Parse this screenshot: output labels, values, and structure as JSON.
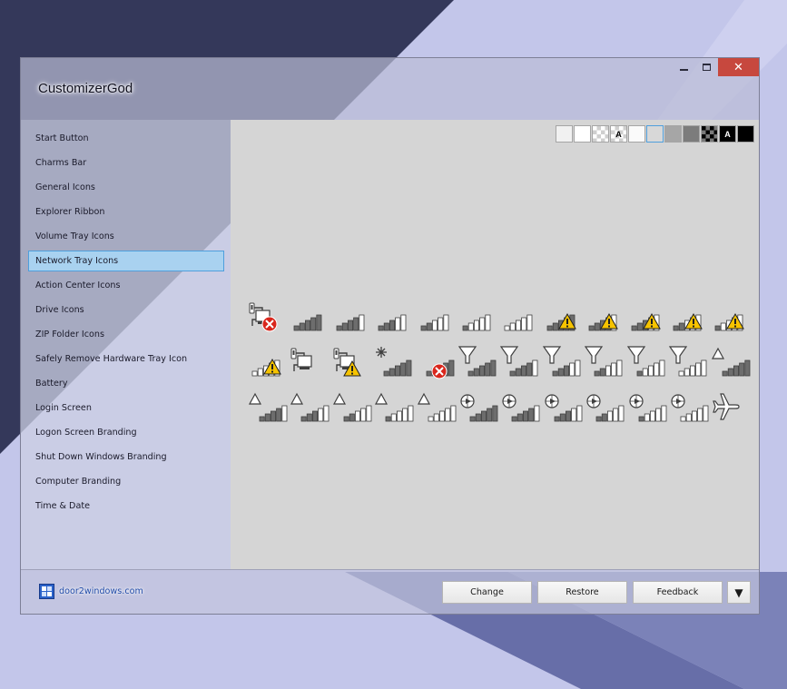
{
  "window": {
    "title": "CustomizerGod"
  },
  "window_controls": {
    "minimize": "–",
    "maximize": "□",
    "close": "✕"
  },
  "sidebar": {
    "items": [
      {
        "label": "Start Button",
        "selected": false
      },
      {
        "label": "Charms Bar",
        "selected": false
      },
      {
        "label": "General Icons",
        "selected": false
      },
      {
        "label": "Explorer Ribbon",
        "selected": false
      },
      {
        "label": "Volume Tray Icons",
        "selected": false
      },
      {
        "label": "Network Tray Icons",
        "selected": true
      },
      {
        "label": "Action Center Icons",
        "selected": false
      },
      {
        "label": "Drive Icons",
        "selected": false
      },
      {
        "label": "ZIP Folder Icons",
        "selected": false
      },
      {
        "label": "Safely Remove Hardware Tray Icon",
        "selected": false
      },
      {
        "label": "Battery",
        "selected": false
      },
      {
        "label": "Login Screen",
        "selected": false
      },
      {
        "label": "Logon Screen Branding",
        "selected": false
      },
      {
        "label": "Shut Down Windows Branding",
        "selected": false
      },
      {
        "label": "Computer Branding",
        "selected": false
      },
      {
        "label": "Time & Date",
        "selected": false
      }
    ]
  },
  "background_swatches": [
    {
      "kind": "light-gray",
      "fill": "#f1f1f1",
      "label": ""
    },
    {
      "kind": "white",
      "fill": "#ffffff",
      "label": ""
    },
    {
      "kind": "checker-light",
      "fill": "#ffffff",
      "label": ""
    },
    {
      "kind": "checker-label",
      "fill": "#ffffff",
      "label": "A"
    },
    {
      "kind": "very-light",
      "fill": "#fafafa",
      "label": ""
    },
    {
      "kind": "selected-gray",
      "fill": "#d8d8d8",
      "label": "",
      "selected": true
    },
    {
      "kind": "mid-gray",
      "fill": "#a6a6a6",
      "label": ""
    },
    {
      "kind": "dark-gray",
      "fill": "#7c7c7c",
      "label": ""
    },
    {
      "kind": "checker-dark",
      "fill": "#3a3a3a",
      "label": ""
    },
    {
      "kind": "black-label",
      "fill": "#000000",
      "label": "A"
    },
    {
      "kind": "black",
      "fill": "#000000",
      "label": ""
    }
  ],
  "icon_rows": [
    [
      "ethernet-error",
      "signal-5",
      "signal-4",
      "signal-3",
      "signal-2",
      "signal-1",
      "signal-0",
      "signal-5-warning",
      "signal-4-warning",
      "signal-3-warning",
      "signal-2-warning",
      "signal-1-warning"
    ],
    [
      "signal-0-warning",
      "ethernet",
      "ethernet-warning",
      "signal-searching",
      "signal-error",
      "funnel-5",
      "funnel-4",
      "funnel-3",
      "funnel-2",
      "funnel-1",
      "funnel-0",
      "triangle-5"
    ],
    [
      "triangle-4",
      "triangle-3",
      "triangle-2",
      "triangle-1",
      "triangle-0",
      "globe-5",
      "globe-4",
      "globe-3",
      "globe-2",
      "globe-1",
      "globe-0",
      "airplane"
    ]
  ],
  "footer": {
    "brand": "door2windows.com",
    "buttons": {
      "change": "Change",
      "restore": "Restore",
      "feedback": "Feedback",
      "dropdown": "▼"
    }
  },
  "colors": {
    "desktop_dark": "#34385a",
    "desktop_light": "#c3c6ea",
    "desktop_stripe": "#676ea8",
    "content_bg": "#d5d5d5",
    "selection_bg": "#a9d2f0",
    "selection_border": "#4f9fdc",
    "close_red": "#c7483e",
    "warning_yellow": "#f6c300",
    "error_red": "#d9261c"
  }
}
